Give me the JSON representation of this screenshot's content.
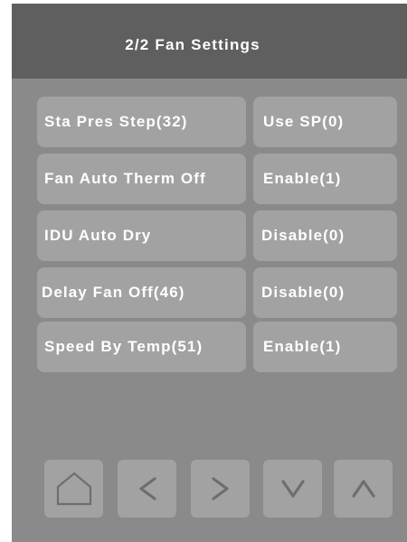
{
  "header": {
    "title": "2/2 Fan Settings"
  },
  "settings": [
    {
      "label": "Sta Pres Step(32)",
      "value": "Use SP(0)"
    },
    {
      "label": "Fan Auto Therm Off",
      "value": "Enable(1)"
    },
    {
      "label": "IDU Auto Dry",
      "value": "Disable(0)"
    },
    {
      "label": "Delay Fan Off(46)",
      "value": "Disable(0)"
    },
    {
      "label": "Speed By Temp(51)",
      "value": "Enable(1)"
    }
  ],
  "nav": {
    "home_icon": "home-icon",
    "prev_icon": "chevron-left-icon",
    "next_icon": "chevron-right-icon",
    "down_icon": "chevron-down-icon",
    "up_icon": "chevron-up-icon"
  },
  "colors": {
    "panel_background": "#8a8a8a",
    "header_background": "#5f5f5f",
    "button_background": "#a2a2a2",
    "text": "#ffffff",
    "icon": "#6e6e6e"
  }
}
